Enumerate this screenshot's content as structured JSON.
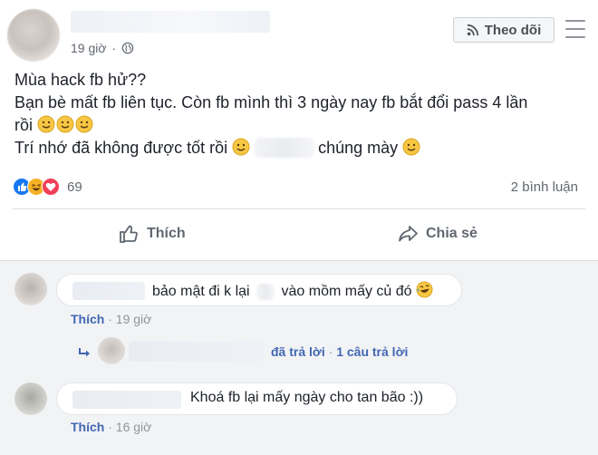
{
  "post": {
    "timestamp": "19 giờ",
    "follow_label": "Theo dõi",
    "text_lines": [
      "Mùa hack fb hử??",
      "Bạn bè mất fb liên tục. Còn fb mình thì 3 ngày nay fb bắt đổi pass 4 lần",
      "rồi",
      "Trí nhớ đã không được tốt rồi",
      "chúng mày"
    ],
    "reaction_count": "69",
    "comment_count": "2 bình luận"
  },
  "actions": {
    "like_label": "Thích",
    "share_label": "Chia sẻ"
  },
  "comments": [
    {
      "text_before": "bảo mật đi k lại",
      "text_after": "vào mồm mấy củ đó",
      "like_label": "Thích",
      "separator": "·",
      "time": "19 giờ",
      "reply": {
        "replied_label": "đã trả lời",
        "separator": "·",
        "reply_count": "1 câu trả lời"
      }
    },
    {
      "text": "Khoá fb lại mấy ngày cho tan bão :))",
      "like_label": "Thích",
      "separator": "·",
      "time": "16 giờ"
    }
  ],
  "colors": {
    "link_blue": "#4267b2",
    "meta_gray": "#90949c",
    "text": "#1d2129",
    "like_blue": "#1877f2",
    "love_red": "#f33e58",
    "haha_yellow": "#f7b125"
  },
  "icons": {
    "globe": "globe-icon",
    "rss": "rss-icon",
    "more": "more-menu-icon",
    "like": "thumbs-up-icon",
    "share": "share-arrow-icon",
    "smile": "smile-emoji-icon",
    "laugh": "laugh-emoji-icon",
    "reply": "reply-arrow-icon"
  }
}
